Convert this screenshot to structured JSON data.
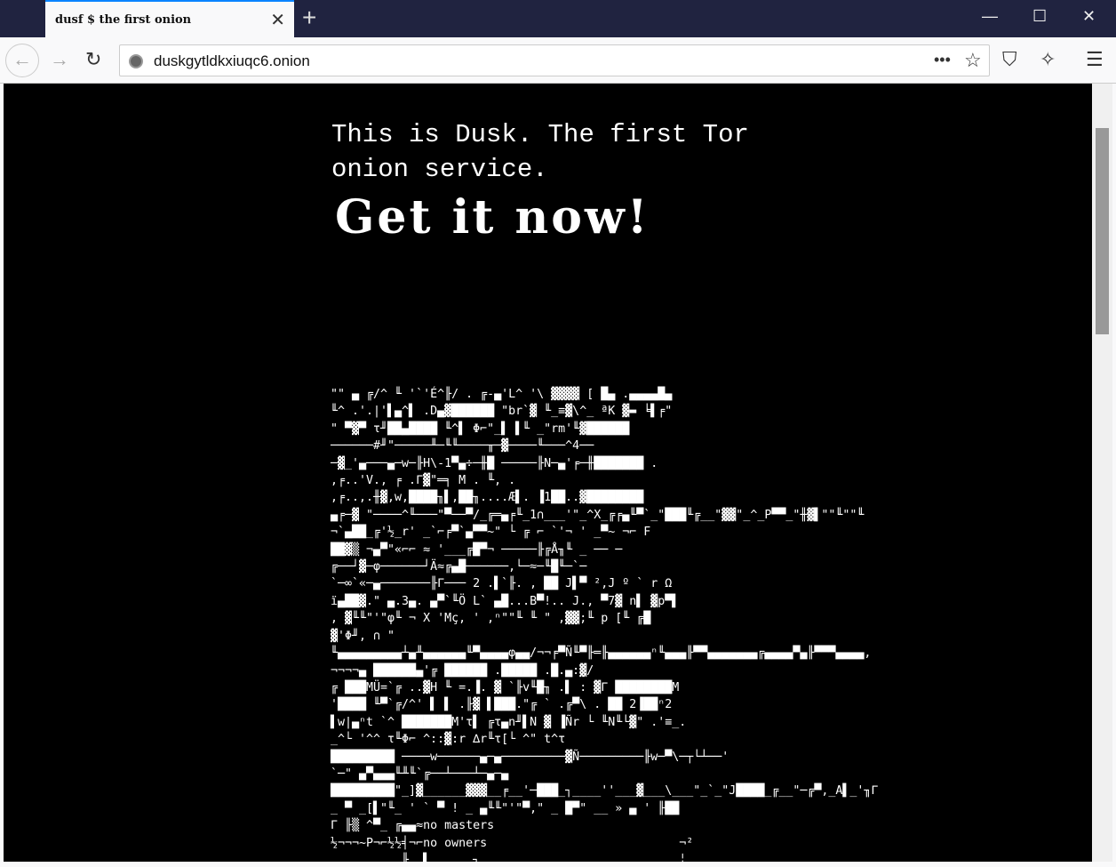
{
  "browser": {
    "tab_title": "dusf $ the first onion",
    "url": "duskgytldkxiuqc6.onion"
  },
  "page": {
    "intro": "This is Dusk. The first Tor onion service.",
    "headline": "Get it now!",
    "art_lines": [
      "\"\" ▄ ╔/^ ╙ '`'É^╟/ . ╔-▄'L^ '\\ ▓▓▓▓ [ █▄ .▄▄▄▄█▄",
      "╙^ .'.|'▌▄^▌ .D▄▓██████ \"br`▓ ╙_≡▓\\^_ ªK ▓▬ ╘▌╒\"",
      "\" ▀▓▀ τ╜██▄████ ╙^▌ Φ⌐\"_▌ ▌╙ _\"rm'╙▓██████",
      "──────#╜\"─────╨─╙╙────╥─▓────╙───^4──",
      "─▓_'▄───▄─w─╟H\\-1▀▄÷─╫█ ─────╟N─▄'╒─╫███████ .",
      ",╒..'V., ╒ .Γ▓\"═╕ M . ╙, .",
      ",╒..,.╫▓,w,████╖▌,██╖....Æ▌. ▐1██..▓████████",
      "▄╒─▓ \"────^╙───\"▀──▀/_╔═▄╒╙_1∩___'\"_^X_╔╒▄╙▀`_\"███╙╔__\"▓▓\"_^_P▀▀_\"╫▓▌\"\"╙\"\"╙",
      "¬`▄██_╔'½_r' _`⌐╒▀`▄▀▀~\" └ ╔ ⌐ `'¬ ' _▀~ ¬⌐ F",
      "██▓▒ ¬▄▀\"«⌐⌐ ≈ '___╔█▀¬ ─────╟╔Å╖╙ _ ── ─",
      "╔──┘▓─φ──────┘Ä≈╔▄█──────,└─≈─╙█╙─`─",
      "`─∞`«─▄───────╟Γ─── 2 .▌`╟. , ██ J▌▀ ²,J º ` r Ω",
      "ï▄██▓.\" ▄.3▄. ▄▀`╙Ö L` ▄█...B▀!.. J., ▀7▓ n▌ ▓p▀▌",
      ", ▓╙╙\"'\"φ╙ ¬ X 'Mç, ' ,ⁿ\"\"╙ ╙ \" ,▓▓;╙ p [╙ ╔█",
      "▓'Φ╜, ∩ \"",
      "╙▄▄▄▄▄▄▄▄▄┴▄╨▄▄▄▄▄▄╙▀▄▄▄▄φ▄▄/¬¬╒▀Ñ╙▀╟═╟▄▄▄▄▄▄ⁿ╙▄▄▄╟▀▀▄▄▄▄▄▄▄╔▄▄▄▄▀▄╟▀▀▀▄▄▄▄,",
      "¬¬¬¬▄ ██████▄'╔ ██████ .█████ .█.▄:▓/",
      "╔ ███MÜ=`╔ ..▓H ╙ =.▐. ▓ `╟v╙█╖ .▌ : ▓Γ ████████M",
      "'████ ╙▀`╔/^' ▌ ▌ .╟▓ ▌███.\"╔ ` .╔▀\\ . ██ 2▐██ⁿ2",
      "▌w|▄ⁿt `^ ███████M'τ▌ ╔τ▄n╜▌N ▓ ▐Ñr └ ╙N╙└▓\" .'≡_.",
      "_^└ '^^ τ╙Φ⌐ ^::▓:r ∆r╙τ[└ ^\" t^τ",
      "█████████ ────w──────▄─▄─────────▓Ñ─────────╟w─▀\\─┬└┴──'",
      "`─\" ▄▀▄▄▄╙╨╙`╔──┴───┴─▄─▄",
      "█████████\"_]▓______▓▓▓__╒__'─███_┐____''___▓___\\___\"_`_\"J████_╔__\"─╔▀,_A▌_'╖Γ",
      "_ ▀ _[▌\"╙_ ' ` ▀ ! _ ▄╙╙\"'\"▀,\" _ █▀\" __ » ▄ ' ╟██",
      "Γ ╟▒ ^▀_ ╔▄▄≈no masters",
      "½¬¬¬~P¬⌐½½╡¬⌐no owners                           ¬²",
      "          ╟  ▌      ┐                            ╎"
    ]
  }
}
